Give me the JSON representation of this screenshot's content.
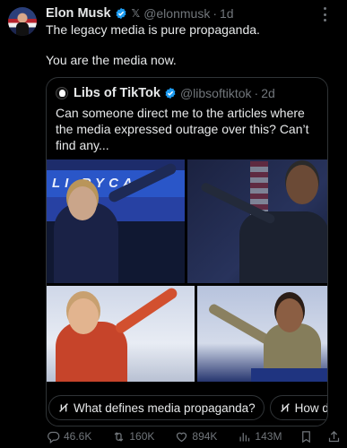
{
  "author": {
    "name": "Elon Musk",
    "handle": "@elonmusk",
    "separator": "·",
    "time": "1d",
    "platform_glyph": "𝕏"
  },
  "post_text": {
    "line1": "The legacy media is pure propaganda.",
    "line2": "You are the media now."
  },
  "quote": {
    "name": "Libs of TikTok",
    "handle": "@libsoftiktok",
    "separator": "·",
    "time": "2d",
    "text": "Can someone direct me to the articles where the media expressed outrage over this? Can’t find any...",
    "images": [
      {
        "banner_text": "LI  RYCA"
      }
    ]
  },
  "grok_chips": [
    {
      "label": "What defines media propaganda?"
    },
    {
      "label": "How dc"
    }
  ],
  "actions": {
    "replies": "46.6K",
    "reposts": "160K",
    "likes": "894K",
    "views": "143M"
  },
  "icons": {
    "verified": "verified-badge-icon",
    "more": "more-options-icon",
    "reply": "reply-icon",
    "repost": "repost-icon",
    "like": "heart-icon",
    "views": "views-icon",
    "bookmark": "bookmark-icon",
    "share": "share-icon",
    "grok": "grok-icon"
  },
  "colors": {
    "background": "#000000",
    "text": "#e7e9ea",
    "muted": "#71767b",
    "border": "#2f3336",
    "verified": "#1d9bf0"
  }
}
